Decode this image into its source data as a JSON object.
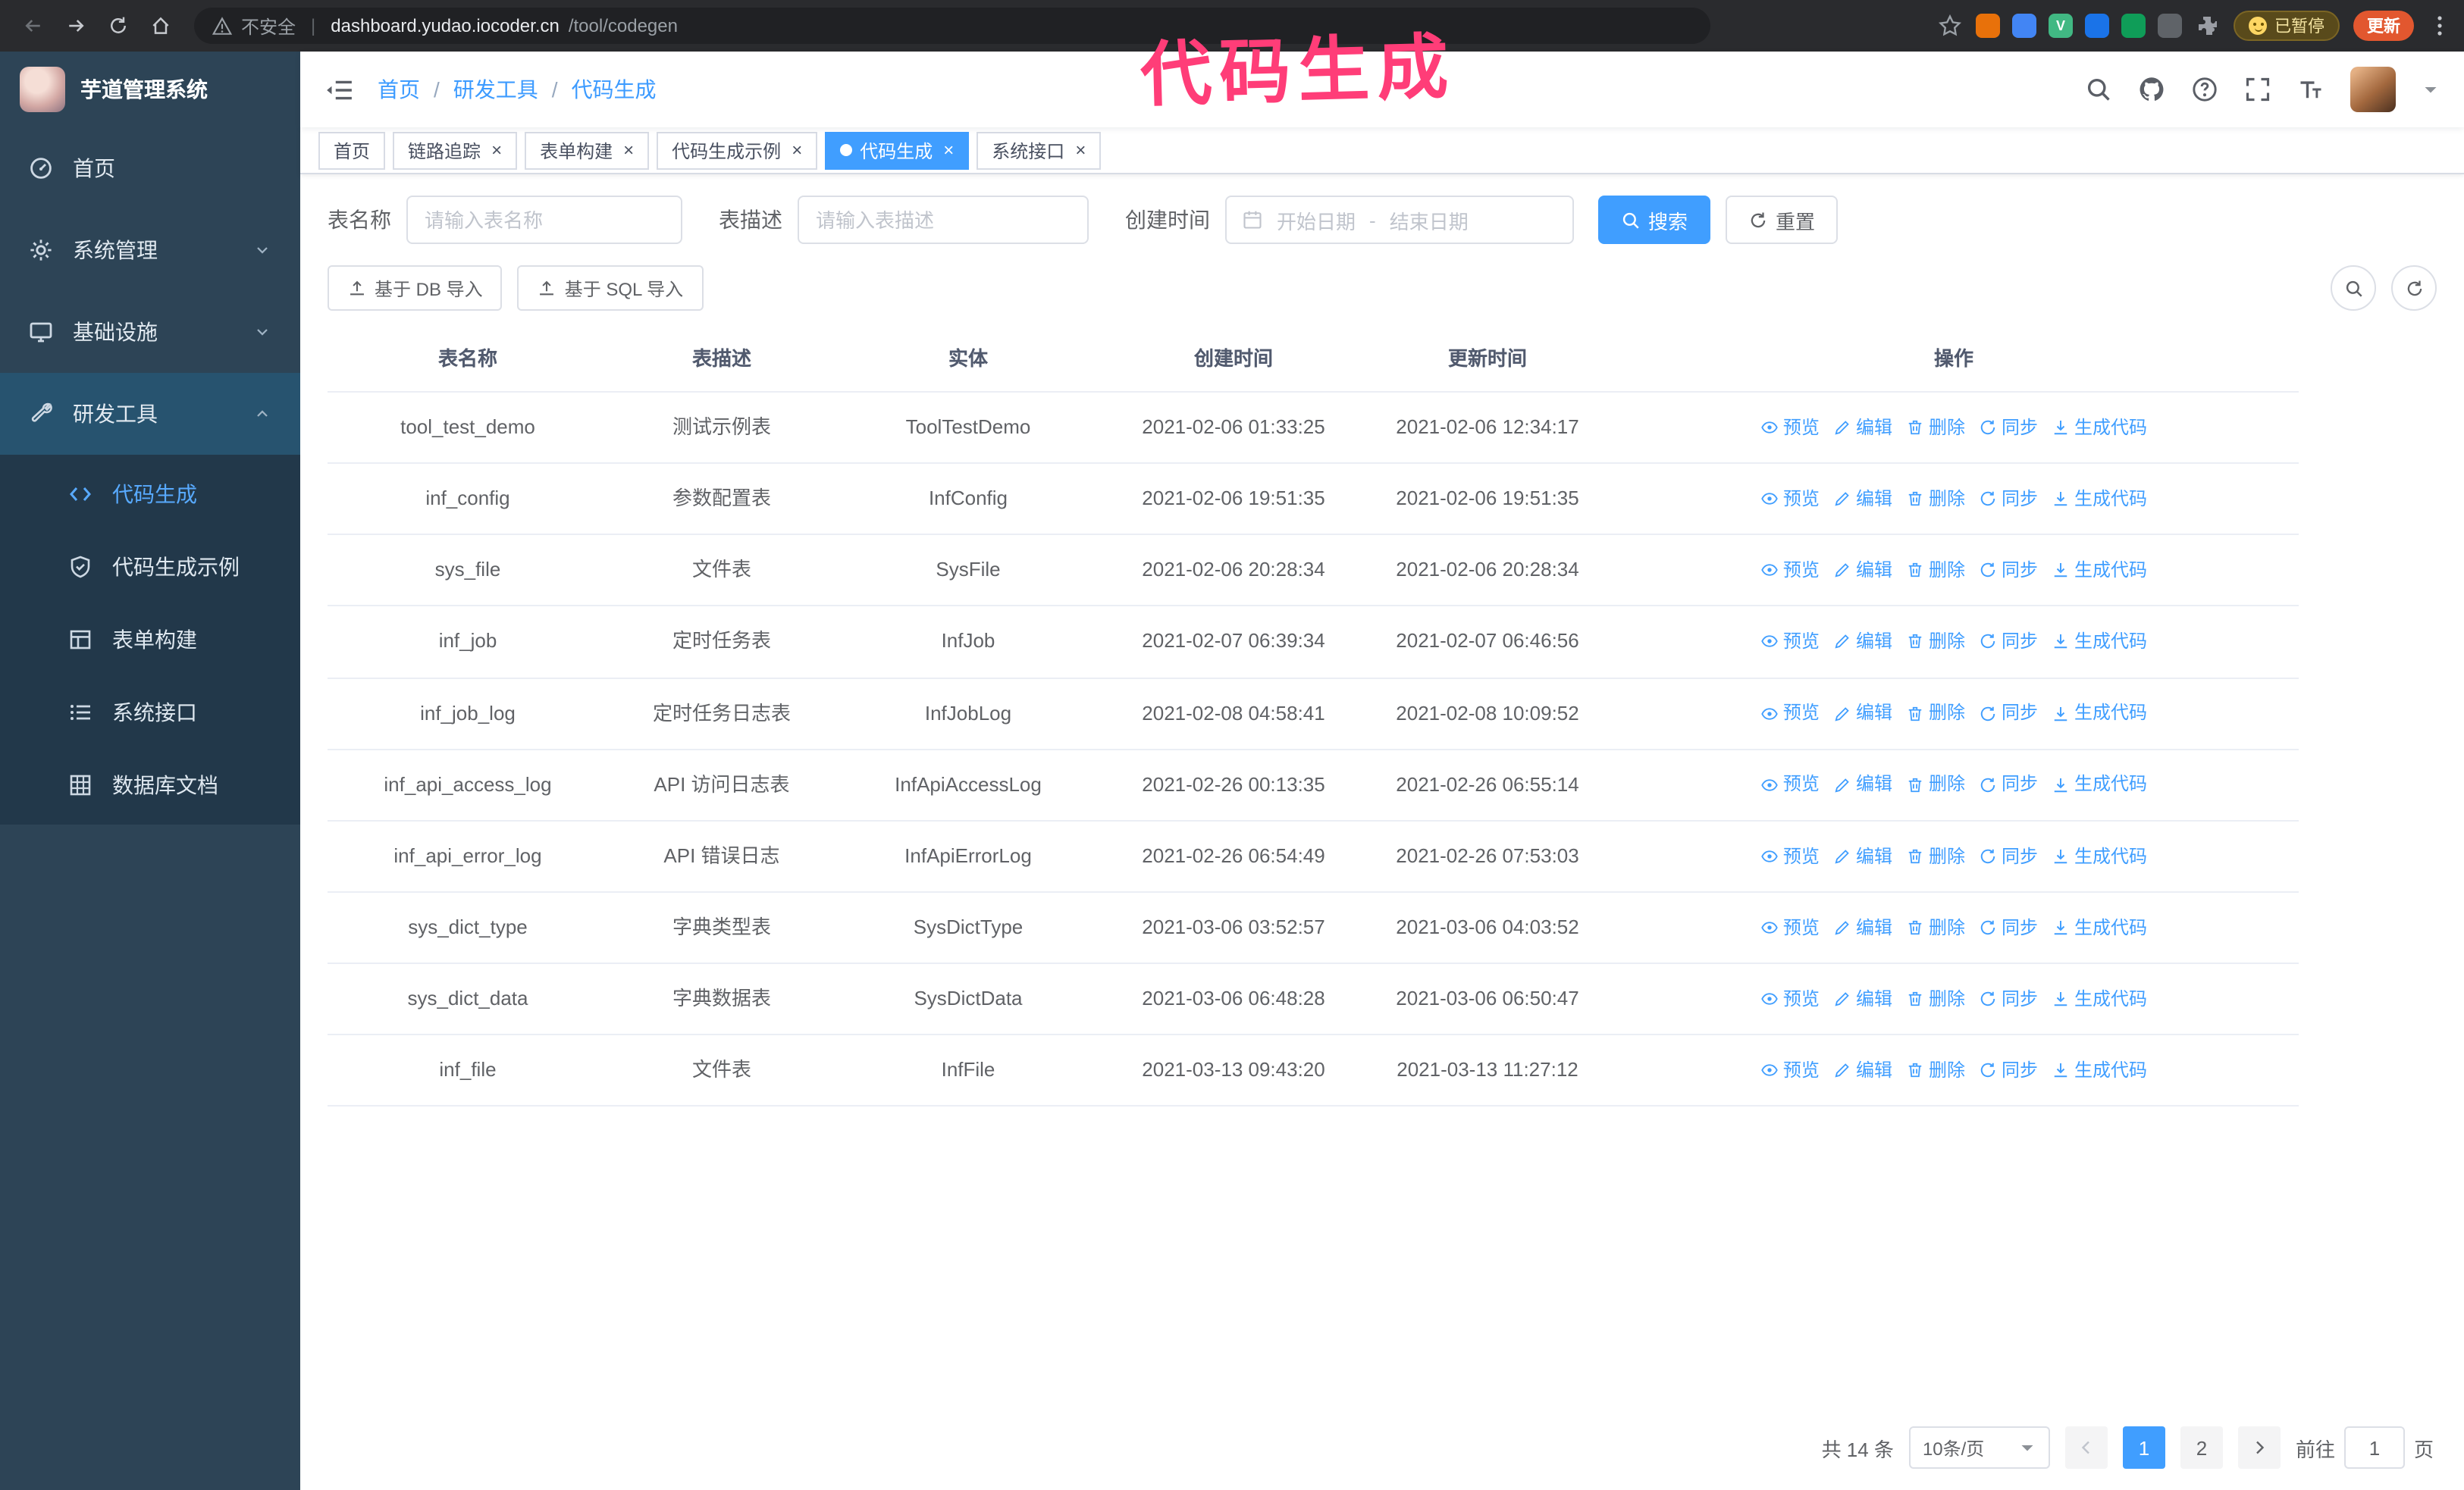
{
  "colors": {
    "accent": "#409eff",
    "sidebar_bg": "#2d4456",
    "annotation": "#ff3d78"
  },
  "annotation": {
    "text": "代码生成"
  },
  "browser": {
    "security_label": "不安全",
    "url_separator": "|",
    "url_domain": "dashboard.yudao.iocoder.cn",
    "url_path": "/tool/codegen",
    "extensions": [
      {
        "color": "#e8710a",
        "label": ""
      },
      {
        "color": "#4285f4",
        "label": ""
      },
      {
        "color": "#41b883",
        "label": "V"
      },
      {
        "color": "#1a73e8",
        "label": ""
      },
      {
        "color": "#0f9d58",
        "label": ""
      },
      {
        "color": "#5f6368",
        "label": ""
      }
    ],
    "paused_badge": "已暂停",
    "update_button": "更新"
  },
  "sidebar": {
    "logo_title": "芋道管理系统",
    "items": [
      {
        "id": "home",
        "label": "首页",
        "icon": "dashboard-icon"
      },
      {
        "id": "system",
        "label": "系统管理",
        "icon": "gear-icon",
        "expandable": true
      },
      {
        "id": "infra",
        "label": "基础设施",
        "icon": "monitor-icon",
        "expandable": true
      },
      {
        "id": "devtools",
        "label": "研发工具",
        "icon": "tool-icon",
        "expandable": true,
        "expanded": true,
        "children": [
          {
            "id": "codegen",
            "label": "代码生成",
            "icon": "code-icon",
            "active": true
          },
          {
            "id": "codegen-example",
            "label": "代码生成示例",
            "icon": "shield-check-icon"
          },
          {
            "id": "form-build",
            "label": "表单构建",
            "icon": "form-grid-icon"
          },
          {
            "id": "api",
            "label": "系统接口",
            "icon": "api-list-icon"
          },
          {
            "id": "db-doc",
            "label": "数据库文档",
            "icon": "database-grid-icon"
          }
        ]
      }
    ]
  },
  "header": {
    "breadcrumb": [
      "首页",
      "研发工具",
      "代码生成"
    ],
    "breadcrumb_separator": "/"
  },
  "tabs": [
    {
      "id": "home",
      "label": "首页",
      "closable": false,
      "active": false
    },
    {
      "id": "trace",
      "label": "链路追踪",
      "closable": true,
      "active": false
    },
    {
      "id": "form-build",
      "label": "表单构建",
      "closable": true,
      "active": false
    },
    {
      "id": "codegen-example",
      "label": "代码生成示例",
      "closable": true,
      "active": false
    },
    {
      "id": "codegen",
      "label": "代码生成",
      "closable": true,
      "active": true
    },
    {
      "id": "api",
      "label": "系统接口",
      "closable": true,
      "active": false
    }
  ],
  "filters": {
    "table_name_label": "表名称",
    "table_name_placeholder": "请输入表名称",
    "table_desc_label": "表描述",
    "table_desc_placeholder": "请输入表描述",
    "create_time_label": "创建时间",
    "date_start_placeholder": "开始日期",
    "date_separator": "-",
    "date_end_placeholder": "结束日期",
    "search_button": "搜索",
    "reset_button": "重置"
  },
  "toolbar": {
    "import_db": "基于 DB 导入",
    "import_sql": "基于 SQL 导入"
  },
  "table": {
    "columns": [
      "表名称",
      "表描述",
      "实体",
      "创建时间",
      "更新时间",
      "操作"
    ],
    "actions": [
      {
        "id": "preview",
        "label": "预览",
        "icon": "eye-icon"
      },
      {
        "id": "edit",
        "label": "编辑",
        "icon": "edit-icon"
      },
      {
        "id": "delete",
        "label": "删除",
        "icon": "delete-icon"
      },
      {
        "id": "sync",
        "label": "同步",
        "icon": "sync-icon"
      },
      {
        "id": "generate",
        "label": "生成代码",
        "icon": "download-icon"
      }
    ],
    "rows": [
      {
        "name": "tool_test_demo",
        "desc": "测试示例表",
        "entity": "ToolTestDemo",
        "created": "2021-02-06 01:33:25",
        "updated": "2021-02-06 12:34:17"
      },
      {
        "name": "inf_config",
        "desc": "参数配置表",
        "entity": "InfConfig",
        "created": "2021-02-06 19:51:35",
        "updated": "2021-02-06 19:51:35"
      },
      {
        "name": "sys_file",
        "desc": "文件表",
        "entity": "SysFile",
        "created": "2021-02-06 20:28:34",
        "updated": "2021-02-06 20:28:34"
      },
      {
        "name": "inf_job",
        "desc": "定时任务表",
        "entity": "InfJob",
        "created": "2021-02-07 06:39:34",
        "updated": "2021-02-07 06:46:56"
      },
      {
        "name": "inf_job_log",
        "desc": "定时任务日志表",
        "entity": "InfJobLog",
        "created": "2021-02-08 04:58:41",
        "updated": "2021-02-08 10:09:52"
      },
      {
        "name": "inf_api_access_log",
        "desc": "API 访问日志表",
        "entity": "InfApiAccessLog",
        "created": "2021-02-26 00:13:35",
        "updated": "2021-02-26 06:55:14"
      },
      {
        "name": "inf_api_error_log",
        "desc": "API 错误日志",
        "entity": "InfApiErrorLog",
        "created": "2021-02-26 06:54:49",
        "updated": "2021-02-26 07:53:03"
      },
      {
        "name": "sys_dict_type",
        "desc": "字典类型表",
        "entity": "SysDictType",
        "created": "2021-03-06 03:52:57",
        "updated": "2021-03-06 04:03:52"
      },
      {
        "name": "sys_dict_data",
        "desc": "字典数据表",
        "entity": "SysDictData",
        "created": "2021-03-06 06:48:28",
        "updated": "2021-03-06 06:50:47"
      },
      {
        "name": "inf_file",
        "desc": "文件表",
        "entity": "InfFile",
        "created": "2021-03-13 09:43:20",
        "updated": "2021-03-13 11:27:12"
      }
    ]
  },
  "pagination": {
    "total_text": "共 14 条",
    "page_size_text": "10条/页",
    "pages": [
      "1",
      "2"
    ],
    "active_page": "1",
    "prev_disabled": true,
    "goto_label": "前往",
    "goto_value": "1",
    "goto_unit": "页"
  }
}
